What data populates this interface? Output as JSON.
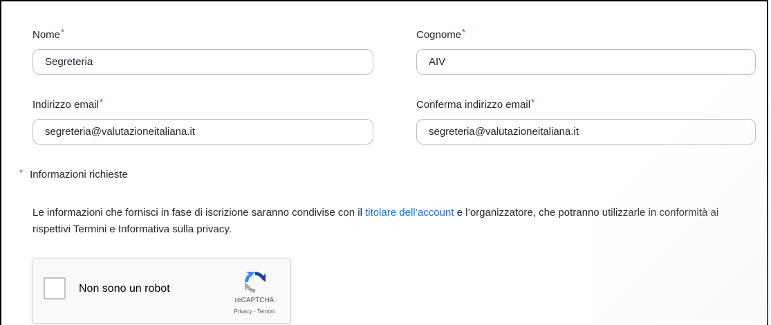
{
  "form": {
    "first_name": {
      "label": "Nome",
      "required_mark": "*",
      "value": "Segreteria"
    },
    "last_name": {
      "label": "Cognome",
      "required_mark": "*",
      "value": "AIV"
    },
    "email": {
      "label": "Indirizzo email",
      "required_mark": "*",
      "value": "segreteria@valutazioneitaliana.it"
    },
    "email_confirm": {
      "label": "Conferma indirizzo email",
      "required_mark": "*",
      "value": "segreteria@valutazioneitaliana.it"
    }
  },
  "required_note": {
    "mark": "*",
    "text": "Informazioni richieste"
  },
  "info": {
    "part1": "Le informazioni che fornisci in fase di iscrizione saranno condivise con il ",
    "link_text": "titolare dell’account",
    "part2": " e l’organizzatore, che potranno utilizzarle in conformità ai rispettivi Termini e Informativa sulla privacy."
  },
  "captcha": {
    "checkbox_label": "Non sono un robot",
    "brand": "reCAPTCHA",
    "privacy_link": "Privacy",
    "separator": " - ",
    "terms_link": "Termini",
    "icon": "recaptcha-logo-icon"
  },
  "colors": {
    "text": "#232333",
    "required": "#e02828",
    "link": "#0e72ed",
    "input_border": "#babacc"
  }
}
